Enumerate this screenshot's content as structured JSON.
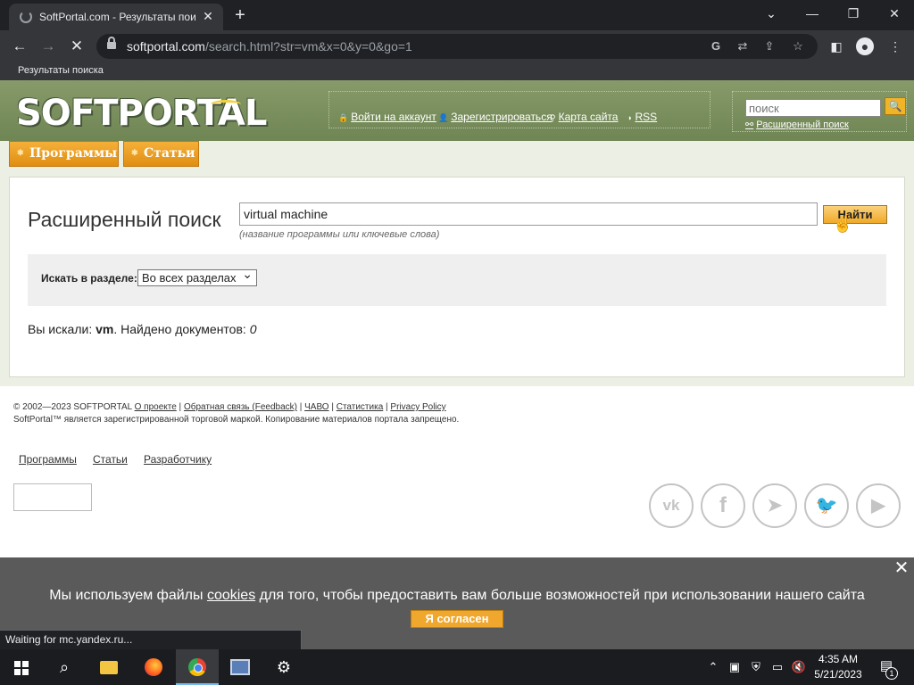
{
  "browser": {
    "tab_title": "SoftPortal.com - Результаты пои",
    "url_host": "softportal.com",
    "url_path": "/search.html?str=vm&x=0&y=0&go=1",
    "bookmark": "Результаты поиска",
    "status_text": "Waiting for mc.yandex.ru..."
  },
  "header": {
    "logo_text": "SOFTPORTAL",
    "logo_mark": "T",
    "links": [
      "Войти на аккаунт",
      "Зарегистрироваться",
      "Карта сайта",
      "RSS"
    ],
    "search_placeholder": "поиск",
    "search_button": "🔍",
    "advanced_search": "Расширенный поиск"
  },
  "nav": {
    "programs": "Программы",
    "articles": "Статьи"
  },
  "search_form": {
    "title": "Расширенный поиск",
    "query": "virtual machine",
    "hint": "(название программы или ключевые слова)",
    "find_button": "Найти",
    "section_label": "Искать в разделе:",
    "section_value": "Во всех разделах",
    "result_prefix": "Вы искали: ",
    "result_query": "vm",
    "result_middle": ". Найдено документов: ",
    "result_count": "0"
  },
  "footer": {
    "copyright": "© 2002—2023 SOFTPORTAL",
    "links": [
      "О проекте",
      "Обратная связь (Feedback)",
      "ЧАВО",
      "Статистика",
      "Privacy Policy"
    ],
    "trademark": "SoftPortal™ является зарегистрированной торговой маркой. Копирование материалов портала запрещено.",
    "bottom_links": [
      "Программы",
      "Статьи",
      "Разработчику"
    ],
    "social": [
      "vk",
      "facebook",
      "telegram",
      "twitter",
      "youtube"
    ]
  },
  "cookie": {
    "text_before": "Мы используем файлы ",
    "link": "cookies",
    "text_after": " для того, чтобы предоставить вам больше возможностей при использовании нашего сайта",
    "agree_button": "Я согласен"
  },
  "taskbar": {
    "time": "4:35 AM",
    "date": "5/21/2023",
    "notification_count": "1"
  },
  "colors": {
    "header_green": "#7b9160",
    "accent_orange": "#f0a72d",
    "chrome_dark": "#35363a"
  }
}
